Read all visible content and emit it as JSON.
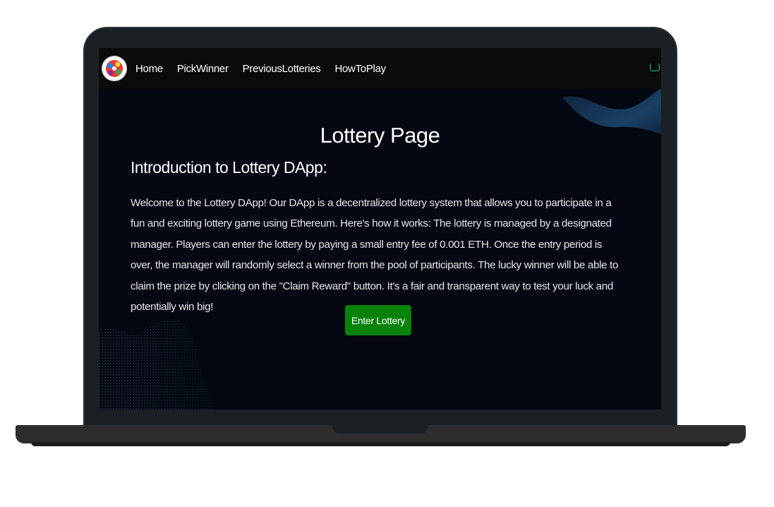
{
  "navbar": {
    "logo_icon": "lottery-logo-icon",
    "links": [
      {
        "label": "Home"
      },
      {
        "label": "PickWinner"
      },
      {
        "label": "PreviousLotteries"
      },
      {
        "label": "HowToPlay"
      }
    ],
    "toggle_icon": "navbar-toggle-icon",
    "accent_color": "#18c98a"
  },
  "main": {
    "title": "Lottery Page",
    "intro_heading": "Introduction to Lottery DApp:",
    "intro_text": "Welcome to the Lottery DApp! Our DApp is a decentralized lottery system that allows you to participate in a fun and exciting lottery game using Ethereum. Here's how it works: The lottery is managed by a designated manager. Players can enter the lottery by paying a small entry fee of 0.001 ETH. Once the entry period is over, the manager will randomly select a winner from the pool of participants. The lucky winner will be able to claim the prize by clicking on the \"Claim Reward\" button. It's a fair and transparent way to test your luck and potentially win big!",
    "enter_button_label": "Enter Lottery",
    "button_color": "#088208",
    "background_color": "#030812"
  }
}
